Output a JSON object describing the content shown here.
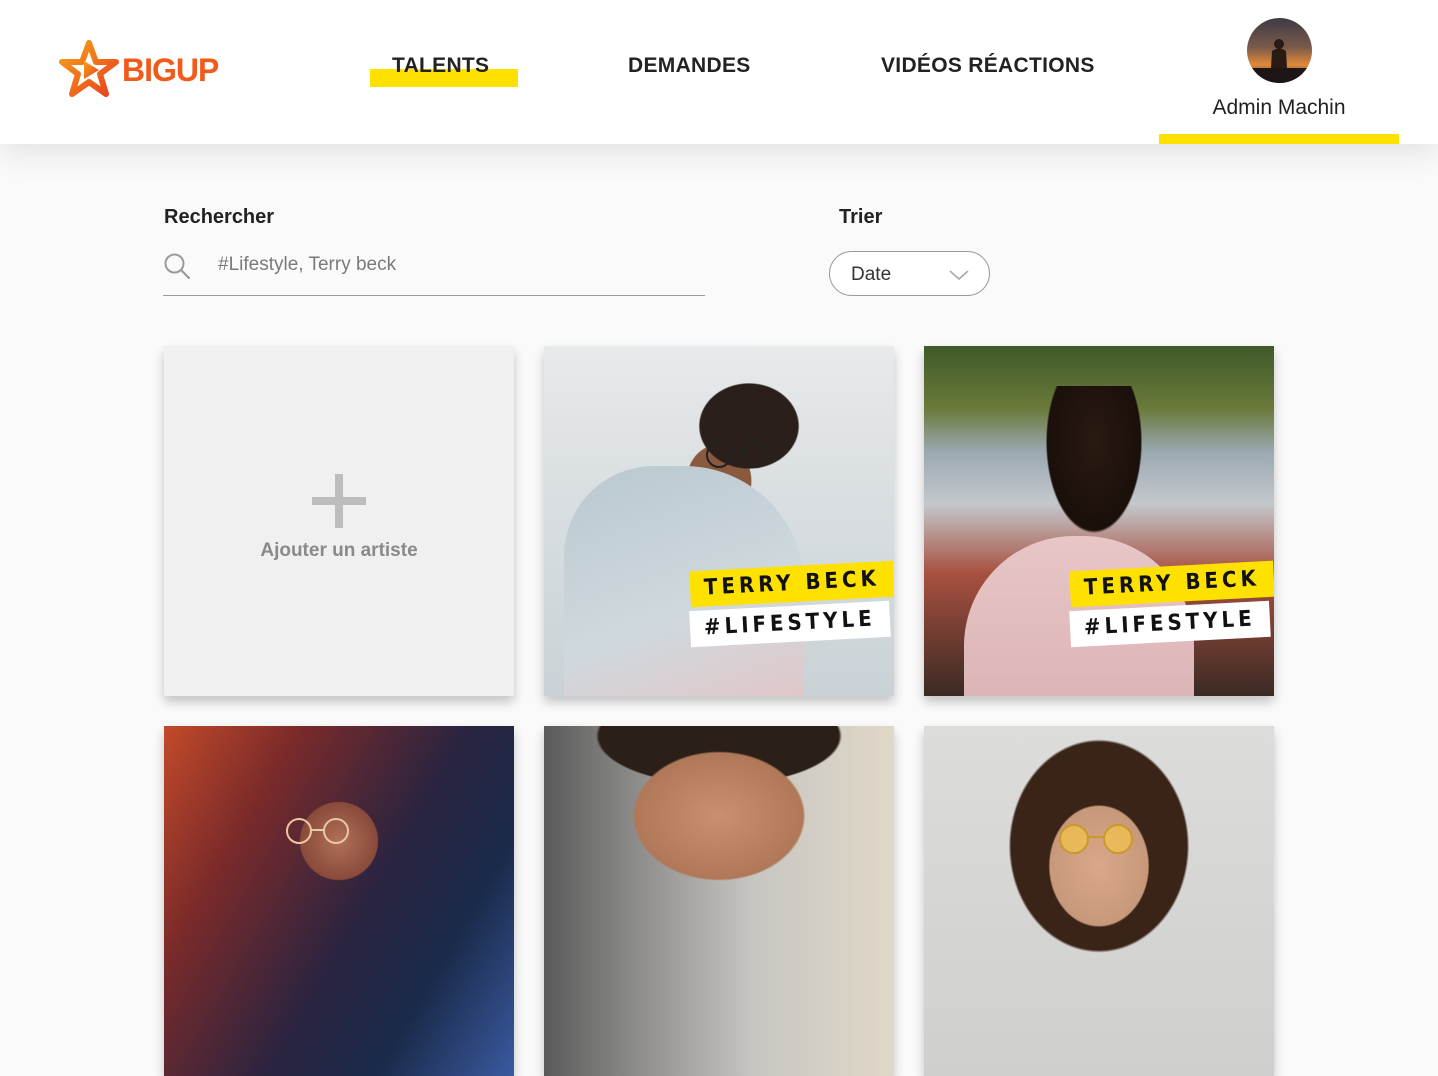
{
  "brand": {
    "name": "BIGUP",
    "accent": "#ffe100",
    "logo_color": "#f05a1a"
  },
  "nav": {
    "items": [
      {
        "label": "TALENTS",
        "active": true
      },
      {
        "label": "DEMANDES",
        "active": false
      },
      {
        "label": "VIDÉOS RÉACTIONS",
        "active": false
      }
    ]
  },
  "user": {
    "name": "Admin Machin"
  },
  "search": {
    "label": "Rechercher",
    "placeholder": "#Lifestyle, Terry beck",
    "value": ""
  },
  "sort": {
    "label": "Trier",
    "selected": "Date"
  },
  "grid": {
    "add_label": "Ajouter un artiste",
    "cards": [
      {
        "name": "TERRY BECK",
        "category": "#LIFESTYLE"
      },
      {
        "name": "TERRY BECK",
        "category": "#LIFESTYLE"
      },
      {
        "name": "",
        "category": ""
      },
      {
        "name": "",
        "category": ""
      },
      {
        "name": "",
        "category": ""
      }
    ]
  }
}
